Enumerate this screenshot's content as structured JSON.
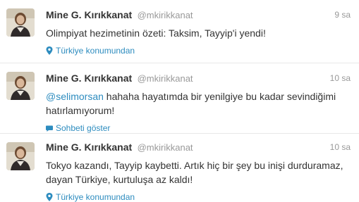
{
  "tweets": [
    {
      "fullname": "Mine G. Kırıkkanat",
      "username": "@mkirikkanat",
      "time": "9 sa",
      "mention": "",
      "text": "Olimpiyat hezimetinin özeti: Taksim, Tayyip'i yendi!",
      "meta_icon": "location-pin-icon",
      "meta_label": "Türkiye konumundan"
    },
    {
      "fullname": "Mine G. Kırıkkanat",
      "username": "@mkirikkanat",
      "time": "10 sa",
      "mention": "@selimorsan",
      "text": " hahaha hayatımda bir yenilgiye bu kadar sevindiğimi hatırlamıyorum!",
      "meta_icon": "speech-bubble-icon",
      "meta_label": "Sohbeti göster"
    },
    {
      "fullname": "Mine G. Kırıkkanat",
      "username": "@mkirikkanat",
      "time": "10 sa",
      "mention": "",
      "text": "Tokyo kazandı, Tayyip kaybetti. Artık hiç bir şey bu inişi durduramaz, dayan Türkiye, kurtuluşa az kaldı!",
      "meta_icon": "location-pin-icon",
      "meta_label": "Türkiye konumundan"
    }
  ],
  "colors": {
    "link": "#2d8cbf",
    "muted": "#999999",
    "text": "#333333",
    "divider": "#e8e8e8"
  }
}
